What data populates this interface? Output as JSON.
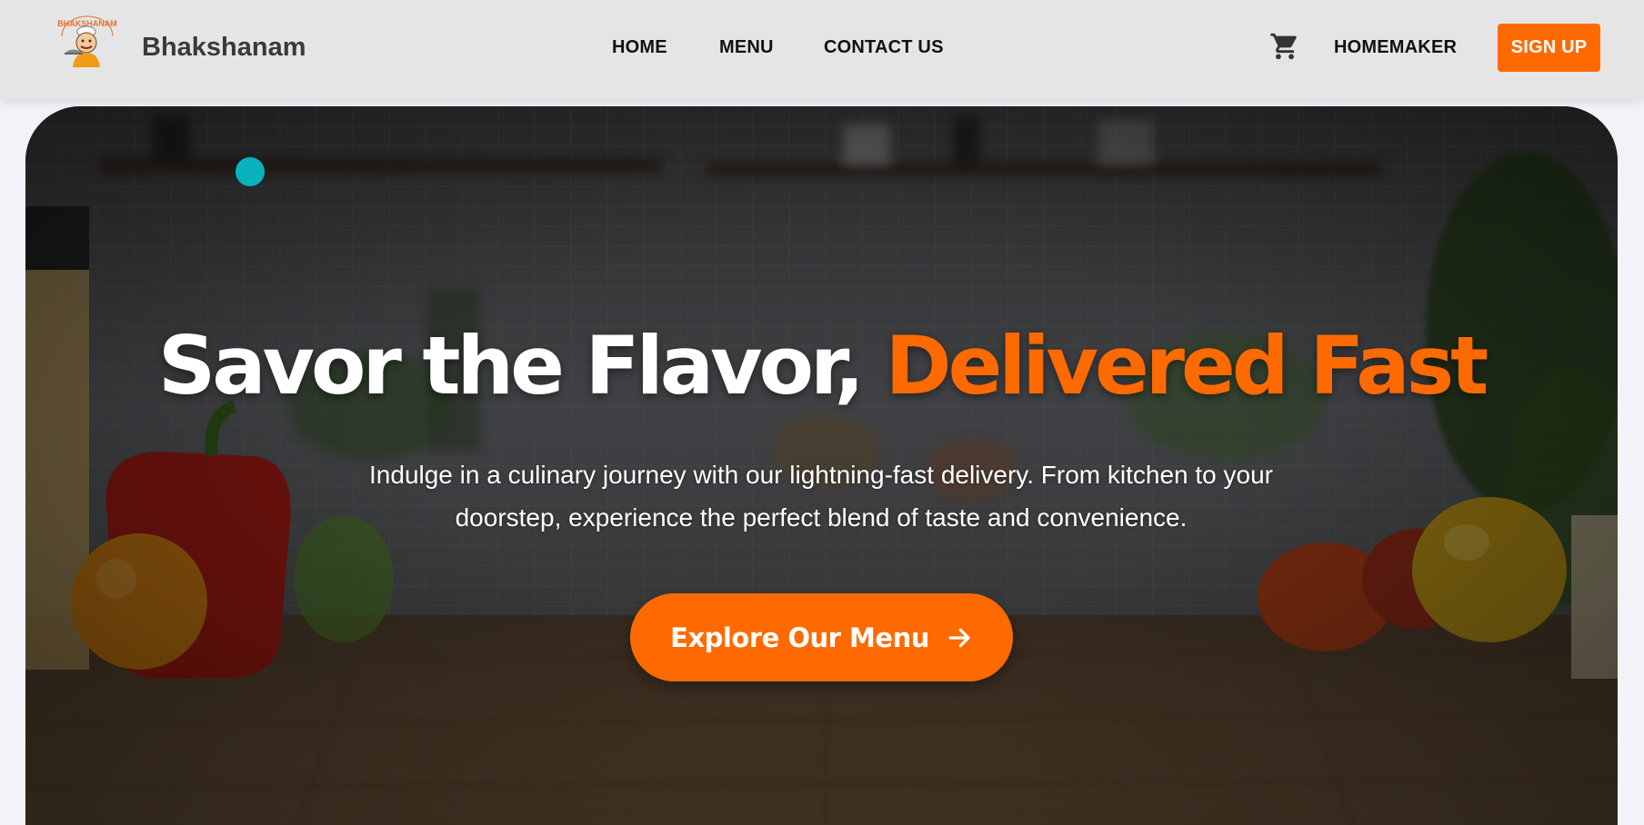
{
  "brand": {
    "name": "Bhakshanam",
    "logo_text": "BHAKSHANAM",
    "logo_icon": "chef-mascot-logo"
  },
  "nav": {
    "links": [
      "HOME",
      "MENU",
      "CONTACT US"
    ],
    "cart_icon": "shopping-cart-icon",
    "homemaker": "HOMEMAKER",
    "signup": "SIGN UP"
  },
  "hero": {
    "headline_white": "Savor the Flavor,",
    "headline_accent": "Delivered Fast",
    "subtitle": "Indulge in a culinary journey with our lightning-fast delivery. From kitchen to your doorstep, experience the perfect blend of taste and convenience.",
    "cta_label": "Explore Our Menu",
    "cta_icon": "arrow-right-icon",
    "background": "kitchen-counter-photo-with-vegetables"
  },
  "colors": {
    "accent": "#ff6a00",
    "navbar_bg": "#e5e5e5",
    "page_bg": "#f3f2f8",
    "dot": "#07b4bd"
  }
}
